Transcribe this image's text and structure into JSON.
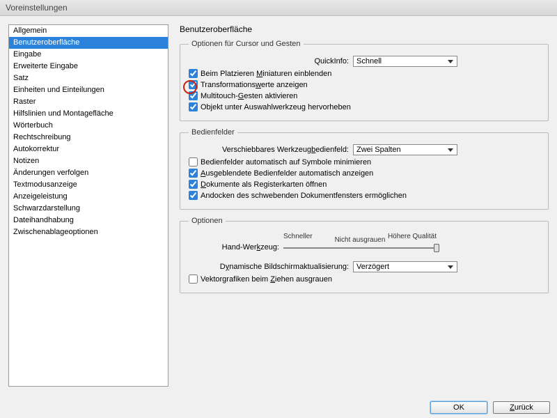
{
  "window": {
    "title": "Voreinstellungen"
  },
  "sidebar": {
    "items": [
      "Allgemein",
      "Benutzeroberfläche",
      "Eingabe",
      "Erweiterte Eingabe",
      "Satz",
      "Einheiten und Einteilungen",
      "Raster",
      "Hilfslinien und Montagefläche",
      "Wörterbuch",
      "Rechtschreibung",
      "Autokorrektur",
      "Notizen",
      "Änderungen verfolgen",
      "Textmodusanzeige",
      "Anzeigeleistung",
      "Schwarzdarstellung",
      "Dateihandhabung",
      "Zwischenablageoptionen"
    ],
    "selected_index": 1
  },
  "main": {
    "title": "Benutzeroberfläche",
    "group_cursor": {
      "legend": "Optionen für Cursor und Gesten",
      "quickinfo_label": "QuickInfo:",
      "quickinfo_value": "Schnell",
      "cb1": {
        "checked": true,
        "pre": "Beim Platzieren ",
        "u": "M",
        "post": "iniaturen einblenden"
      },
      "cb2": {
        "checked": true,
        "pre": "Transformations",
        "u": "w",
        "post": "erte anzeigen"
      },
      "cb3": {
        "checked": true,
        "pre": "Multitouch-",
        "u": "G",
        "post": "esten aktivieren"
      },
      "cb4": {
        "checked": true,
        "pre": "Objekt unter Auswahlwerkzeug hervorheben",
        "u": "",
        "post": ""
      }
    },
    "group_panels": {
      "legend": "Bedienfelder",
      "tool_label_pre": "Verschiebbares Werkzeug",
      "tool_label_u": "b",
      "tool_label_post": "edienfeld:",
      "tool_value": "Zwei Spalten",
      "cb1": {
        "checked": false,
        "pre": "Bedienfelder automatisch auf Symbole minimieren",
        "u": "",
        "post": ""
      },
      "cb2": {
        "checked": true,
        "pre": "",
        "u": "A",
        "post": "usgeblendete Bedienfelder automatisch anzeigen"
      },
      "cb3": {
        "checked": true,
        "pre": "",
        "u": "D",
        "post": "okumente als Registerkarten öffnen"
      },
      "cb4": {
        "checked": true,
        "pre": "Andocken des schwebenden Dokumentfensters ermöglichen",
        "u": "",
        "post": ""
      }
    },
    "group_options": {
      "legend": "Optionen",
      "slider_left": "Schneller",
      "slider_right": "Höhere Qualität",
      "slider_tick": "Nicht ausgrauen",
      "hand_tool_pre": "Hand-Wer",
      "hand_tool_u": "k",
      "hand_tool_post": "zeug:",
      "dyn_label_pre": "D",
      "dyn_label_u": "y",
      "dyn_label_post": "namische Bildschirmaktualisierung:",
      "dyn_value": "Verzögert",
      "cb1": {
        "checked": false,
        "pre": "Vektorgrafiken beim ",
        "u": "Z",
        "post": "iehen ausgrauen"
      }
    }
  },
  "footer": {
    "ok": "OK",
    "back_pre": "",
    "back_u": "Z",
    "back_post": "urück"
  }
}
